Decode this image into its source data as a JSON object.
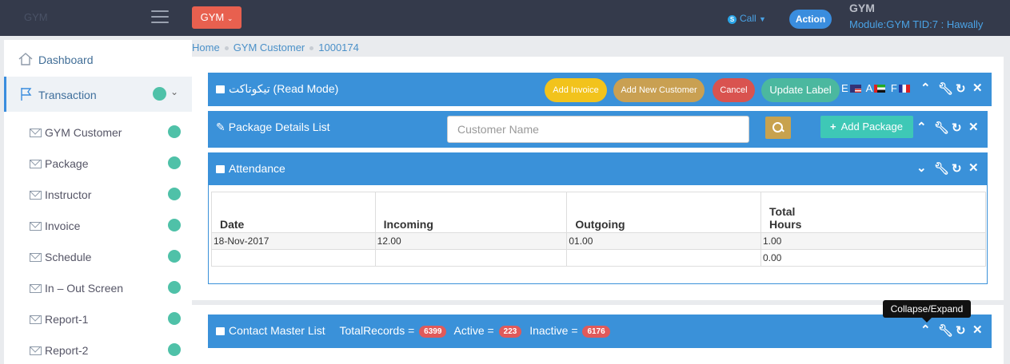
{
  "topbar": {
    "logo_text": "GYM",
    "module_button": "GYM",
    "call_label": "Call",
    "action_label": "Action",
    "user_name": "GYM",
    "user_meta": "Module:GYM  TID:7 : Hawally"
  },
  "sidebar": {
    "dashboard": "Dashboard",
    "transaction": "Transaction",
    "items": [
      "GYM Customer",
      "Package",
      "Instructor",
      "Invoice",
      "Schedule",
      "In – Out Screen",
      "Report-1",
      "Report-2"
    ]
  },
  "breadcrumb": [
    "Home",
    "GYM Customer",
    "1000174"
  ],
  "read_panel": {
    "title": "تيكوتاكت (Read Mode)",
    "add_invoice": "Add Invoice",
    "add_new_customer": "Add New Customer",
    "cancel": "Cancel",
    "update_label": "Update Label",
    "lang_e": "E",
    "lang_a": "A",
    "lang_f": "F"
  },
  "package_panel": {
    "title": "Package Details List",
    "customer_placeholder": "Customer Name",
    "add_package": "Add Package"
  },
  "attendance_panel": {
    "title": "Attendance",
    "columns": [
      "Date",
      "Incoming",
      "Outgoing",
      "Total Hours"
    ],
    "rows": [
      [
        "18-Nov-2017",
        "12.00",
        "01.00",
        "1.00"
      ],
      [
        "",
        "",
        "",
        "0.00"
      ]
    ]
  },
  "contact_panel": {
    "title": "Contact Master List",
    "total_label": "TotalRecords =",
    "total_value": "6399",
    "active_label": "Active =",
    "active_value": "223",
    "inactive_label": "Inactive =",
    "inactive_value": "6176"
  },
  "tooltip": "Collapse/Expand",
  "colors": {
    "topbar": "#343a4b",
    "panel_blue": "#3a91d9",
    "add_invoice": "#f2c31c",
    "add_new_customer": "#c9a052",
    "cancel": "#d9534f",
    "update_label": "#4bb89f",
    "add_package": "#3ec8b6",
    "badge": "#e05a5a"
  }
}
